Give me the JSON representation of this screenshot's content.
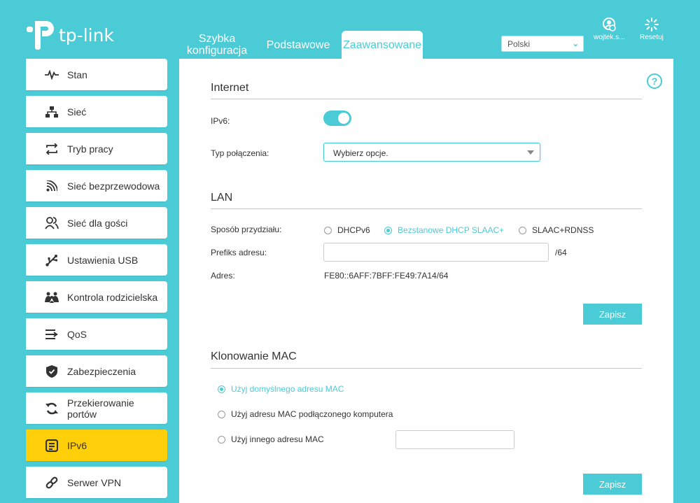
{
  "brand": {
    "name": "tp-link"
  },
  "tabs": [
    {
      "label_line1": "Szybka",
      "label_line2": "konfiguracja"
    },
    {
      "label": "Podstawowe"
    },
    {
      "label": "Zaawansowane",
      "active": true
    }
  ],
  "language": {
    "selected": "Polski"
  },
  "top_actions": {
    "user_label": "wojtek.s...",
    "reset_label": "Resetuj"
  },
  "sidebar": {
    "items": [
      {
        "label": "Stan",
        "icon": "pulse-icon"
      },
      {
        "label": "Sieć",
        "icon": "network-icon"
      },
      {
        "label": "Tryb pracy",
        "icon": "mode-swap-icon"
      },
      {
        "label": "Sieć bezprzewodowa",
        "icon": "wifi-icon"
      },
      {
        "label": "Sieć dla gości",
        "icon": "guests-icon"
      },
      {
        "label": "Ustawienia USB",
        "icon": "usb-icon"
      },
      {
        "label": "Kontrola rodzicielska",
        "icon": "family-icon"
      },
      {
        "label": "QoS",
        "icon": "qos-icon"
      },
      {
        "label": "Zabezpieczenia",
        "icon": "shield-icon"
      },
      {
        "label_line1": "Przekierowanie",
        "label_line2": "portów",
        "icon": "port-forward-icon"
      },
      {
        "label": "IPv6",
        "icon": "ipv6-icon",
        "active": true
      },
      {
        "label": "Serwer VPN",
        "icon": "vpn-link-icon"
      }
    ]
  },
  "help": {
    "glyph": "?"
  },
  "internet": {
    "title": "Internet",
    "ipv6_label": "IPv6:",
    "ipv6_enabled": true,
    "conn_type_label": "Typ połączenia:",
    "conn_type_value": "Wybierz opcje."
  },
  "lan": {
    "title": "LAN",
    "assign_label": "Sposób przydziału:",
    "assign_options": [
      "DHCPv6",
      "Bezstanowe DHCP SLAAC+",
      "SLAAC+RDNSS"
    ],
    "assign_selected": "Bezstanowe DHCP SLAAC+",
    "prefix_label": "Prefiks adresu:",
    "prefix_value": "",
    "prefix_suffix": "/64",
    "address_label": "Adres:",
    "address_value": "FE80::6AFF:7BFF:FE49:7A14/64",
    "save_label": "Zapisz"
  },
  "mac": {
    "title": "Klonowanie MAC",
    "options": [
      "Użyj domyślnego adresu MAC",
      "Użyj adresu MAC podłączonego komputera",
      "Użyj innego adresu MAC"
    ],
    "selected": "Użyj domyślnego adresu MAC",
    "custom_value": "",
    "save_label": "Zapisz"
  },
  "colors": {
    "accent": "#4acbd6",
    "active_nav": "#ffcf0a",
    "panel": "#ffffff"
  }
}
